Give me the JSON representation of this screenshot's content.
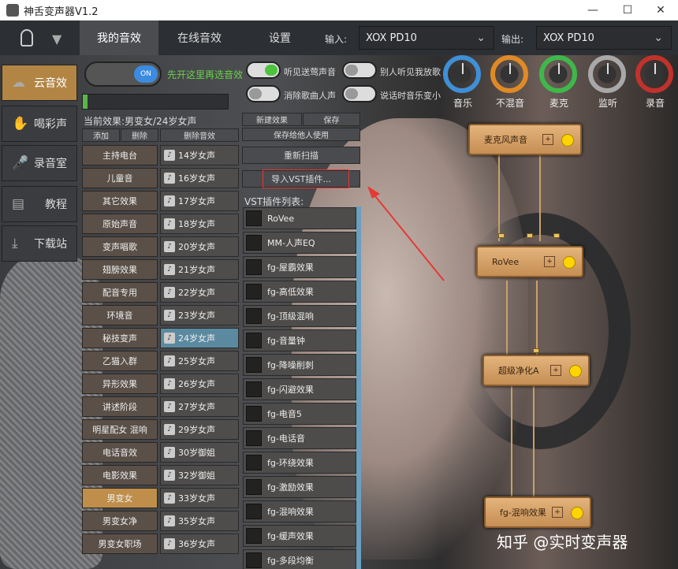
{
  "window": {
    "title": "神舌变声器V1.2",
    "min": "—",
    "max": "☐",
    "close": "✕"
  },
  "nav": {
    "tabs": [
      {
        "label": "我的音效",
        "active": true
      },
      {
        "label": "在线音效",
        "active": false
      },
      {
        "label": "设置",
        "active": false
      }
    ],
    "input_label": "输入:",
    "input_value": "XOX PD10",
    "output_label": "输出:",
    "output_value": "XOX PD10"
  },
  "sidebar": {
    "items": [
      {
        "label": "云音效",
        "icon": "cloud-icon",
        "active": true
      },
      {
        "label": "喝彩声",
        "icon": "cheer-icon",
        "active": false
      },
      {
        "label": "录音室",
        "icon": "microphone-icon",
        "active": false
      },
      {
        "label": "教程",
        "icon": "guide-icon",
        "active": false
      },
      {
        "label": "下载站",
        "icon": "download-icon",
        "active": false
      }
    ]
  },
  "switch_main": {
    "state": "ON",
    "hint": "先开这里再选音效"
  },
  "progress": {
    "fill": 0.03
  },
  "current_effect": "当前效果:男变女/24岁女声",
  "list_buttons": {
    "add": "添加",
    "delete": "删除",
    "delete_effect": "删除音效"
  },
  "categories": [
    "主持电台",
    "儿童音",
    "其它效果",
    "原始声音",
    "变声唱歌",
    "翅膀效果",
    "配音专用",
    "环境音",
    "秘技变声",
    "乙猫入群",
    "异形效果",
    "讲述阶段",
    "明星配女 混响",
    "电话音效",
    "电影效果",
    "男变女",
    "男变女净",
    "男变女职场"
  ],
  "selected_category": "男变女",
  "presets": [
    "14岁女声",
    "16岁女声",
    "17岁女声",
    "18岁女声",
    "20岁女声",
    "21岁女声",
    "22岁女声",
    "23岁女声",
    "24岁女声",
    "25岁女声",
    "26岁女声",
    "27岁女声",
    "29岁女声",
    "30岁御姐",
    "32岁御姐",
    "33岁女声",
    "35岁女声",
    "36岁女声"
  ],
  "selected_preset": "24岁女声",
  "toggles": [
    {
      "label": "听见送莺声音",
      "on": true
    },
    {
      "label": "别人听见我放歌",
      "on": false
    },
    {
      "label": "消除歌曲人声",
      "on": false
    },
    {
      "label": "说话时音乐变小",
      "on": false
    }
  ],
  "knobs": [
    {
      "label": "音乐",
      "color": "#3f8fd6"
    },
    {
      "label": "不混音",
      "color": "#e08a26"
    },
    {
      "label": "麦克",
      "color": "#3fb84a"
    },
    {
      "label": "监听",
      "color": "#a8a8a8"
    },
    {
      "label": "录音",
      "color": "#c0322b"
    }
  ],
  "effects_buttons": {
    "new": "新建效果",
    "save": "保存",
    "save_personal": "保存给他人使用",
    "rescan": "重新扫描",
    "import_vst": "导入VST插件..."
  },
  "vst": {
    "title": "VST插件列表:",
    "items": [
      "RoVee",
      "MM-人声EQ",
      "fg-屋霸效果",
      "fg-高低效果",
      "fg-顶级混响",
      "fg-音量钟",
      "fg-降噪削刺",
      "fg-闪避效果",
      "fg-电音5",
      "fg-电话音",
      "fg-环绕效果",
      "fg-激励效果",
      "fg-混响效果",
      "fg-缓声效果",
      "fg-多段均衡"
    ]
  },
  "chain": {
    "nodes": [
      {
        "label": "麦克风声音",
        "box": "+"
      },
      {
        "label": "RoVee",
        "box": "+"
      },
      {
        "label": "超级净化A",
        "box": "+"
      },
      {
        "label": "fg-混响效果",
        "box": "+"
      }
    ]
  },
  "watermark": "知乎 @实时变声器"
}
